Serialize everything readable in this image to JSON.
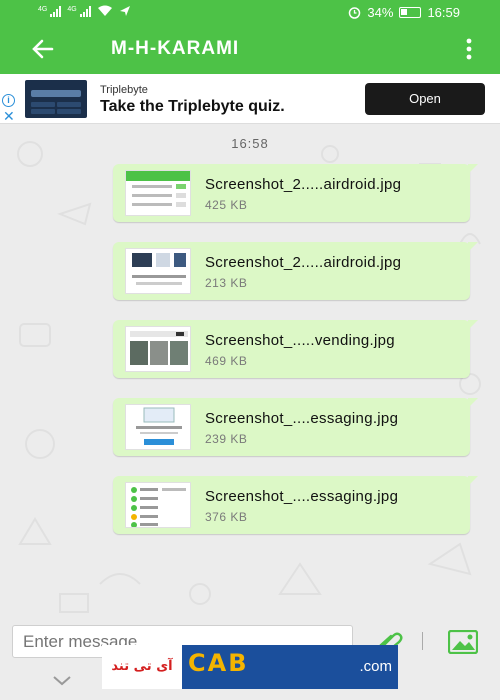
{
  "status_bar": {
    "net1": "4G",
    "net2": "4G",
    "battery": "34%",
    "time": "16:59"
  },
  "app_bar": {
    "title": "M-H-KARAMI"
  },
  "ad": {
    "brand": "Triplebyte",
    "headline": "Take the Triplebyte quiz.",
    "cta": "Open"
  },
  "chat": {
    "timestamp": "16:58",
    "messages": [
      {
        "file_name": "Screenshot_2.....airdroid.jpg",
        "file_size": "425 KB"
      },
      {
        "file_name": "Screenshot_2.....airdroid.jpg",
        "file_size": "213 KB"
      },
      {
        "file_name": "Screenshot_.....vending.jpg",
        "file_size": "469 KB"
      },
      {
        "file_name": "Screenshot_....essaging.jpg",
        "file_size": "239 KB"
      },
      {
        "file_name": "Screenshot_....essaging.jpg",
        "file_size": "376 KB"
      }
    ]
  },
  "composer": {
    "placeholder": "Enter message"
  },
  "watermark": {
    "left_text": "آی تی تند",
    "logo_text": "CAB",
    "domain": ".com"
  },
  "colors": {
    "primary": "#4dc247",
    "bubble": "#dcf8c6",
    "ad_button": "#1a1a1a"
  },
  "icons": [
    "signal-icon",
    "wifi-icon",
    "location-icon",
    "alarm-icon",
    "battery-icon",
    "back-arrow-icon",
    "more-vert-icon",
    "info-icon",
    "close-icon",
    "attach-icon",
    "gallery-icon",
    "chevron-down-icon"
  ]
}
